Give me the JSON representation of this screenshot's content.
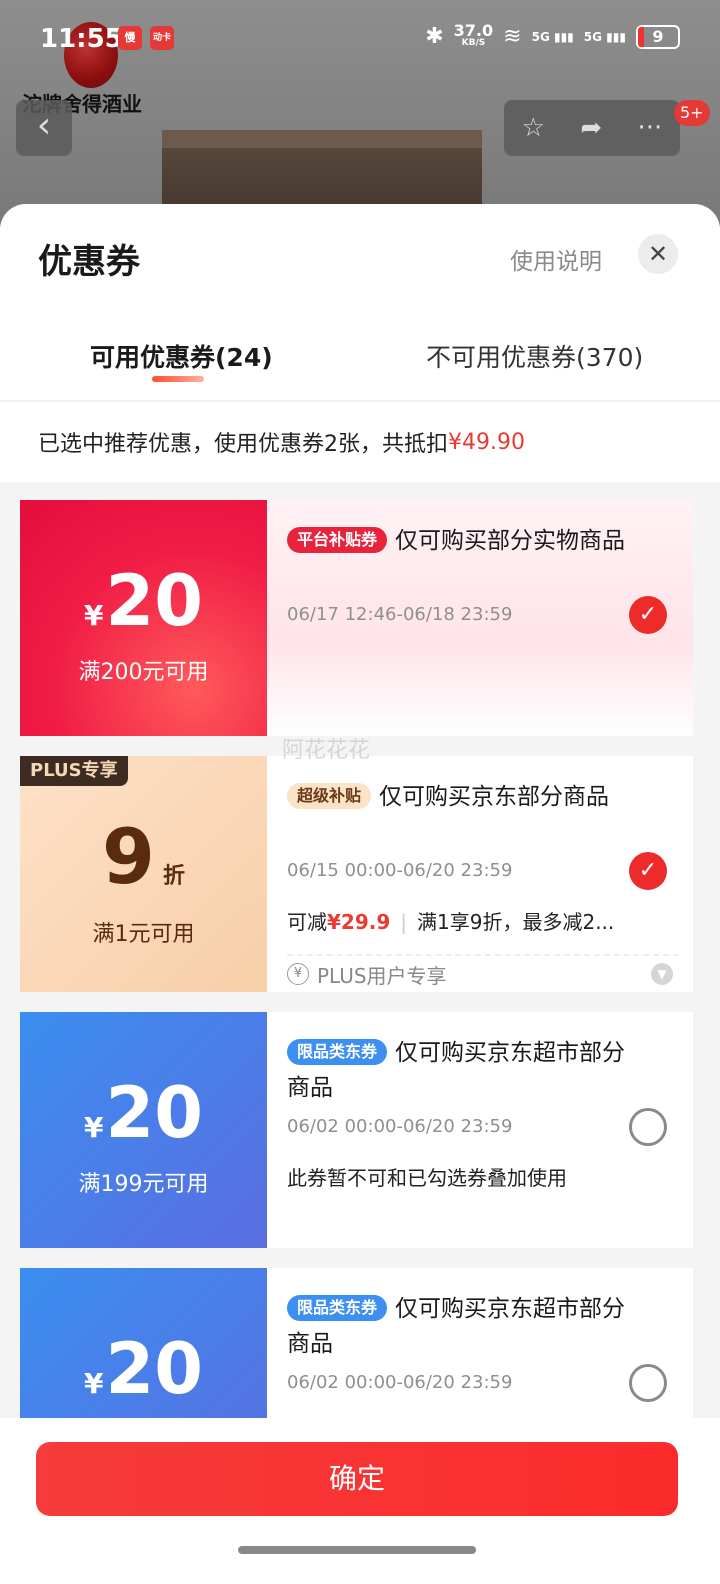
{
  "status_bar": {
    "time": "11:55",
    "app_badge_1": "慢",
    "app_badge_2": "动卡",
    "network_speed": "37.0",
    "network_unit": "KB/S",
    "signal_1": "5G",
    "signal_2": "5G",
    "battery": "9"
  },
  "page_header": {
    "brand_text": "沱牌舍得酒业",
    "notification_count": "5+"
  },
  "sheet": {
    "title": "优惠券",
    "help_link": "使用说明",
    "tabs": [
      {
        "label": "可用优惠券(24)",
        "active": true
      },
      {
        "label": "不可用优惠券(370)",
        "active": false
      }
    ],
    "summary_prefix": "已选中推荐优惠，使用优惠券2张，共抵扣",
    "summary_amount": "¥49.90"
  },
  "coupons": [
    {
      "currency": "¥",
      "value": "20",
      "condition": "满200元可用",
      "tag": "平台补贴券",
      "title": "仅可购买部分实物商品",
      "date": "06/17 12:46-06/18 23:59",
      "selected": true
    },
    {
      "badge": "PLUS专享",
      "value": "9",
      "unit": "折",
      "condition": "满1元可用",
      "tag": "超级补贴",
      "title": "仅可购买京东部分商品",
      "date": "06/15 00:00-06/20 23:59",
      "note_prefix": "可减",
      "note_amount": "¥29.9",
      "note_suffix": "满1享9折，最多减2...",
      "footer_icon": "¥",
      "footer_label": "PLUS用户专享",
      "selected": true
    },
    {
      "currency": "¥",
      "value": "20",
      "condition": "满199元可用",
      "tag": "限品类东券",
      "title": "仅可购买京东超市部分商品",
      "date": "06/02 00:00-06/20 23:59",
      "note": "此券暂不可和已勾选券叠加使用",
      "selected": false
    },
    {
      "currency": "¥",
      "value": "20",
      "tag": "限品类东券",
      "title": "仅可购买京东超市部分商品",
      "date": "06/02 00:00-06/20 23:59",
      "selected": false
    }
  ],
  "watermark": "阿花花花",
  "confirm_label": "确定",
  "colors": {
    "accent_red": "#e93b32",
    "coupon_red": "#e8243c",
    "coupon_blue": "#3d8ff0",
    "plus_gold": "#f7cfa8"
  }
}
